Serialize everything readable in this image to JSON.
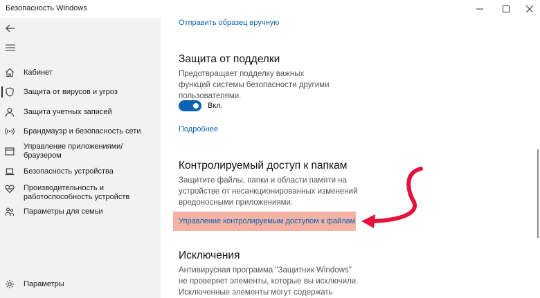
{
  "window": {
    "title": "Безопасность Windows",
    "minimize_icon": "minimize-icon",
    "maximize_icon": "maximize-icon",
    "close_icon": "close-icon"
  },
  "sidebar": {
    "back_icon": "back-arrow-icon",
    "menu_icon": "hamburger-icon",
    "items": [
      {
        "label": "Кабинет",
        "icon": "home-icon"
      },
      {
        "label": "Защита от вирусов и угроз",
        "icon": "shield-icon",
        "active": true
      },
      {
        "label": "Защита учетных записей",
        "icon": "person-icon"
      },
      {
        "label": "Брандмауэр и безопасность сети",
        "icon": "wifi-icon"
      },
      {
        "label": "Управление приложениями/браузером",
        "icon": "app-window-icon"
      },
      {
        "label": "Безопасность устройства",
        "icon": "laptop-icon"
      },
      {
        "label": "Производительность и работоспособность устройств",
        "icon": "heart-icon"
      },
      {
        "label": "Параметры для семьи",
        "icon": "family-icon"
      }
    ],
    "settings": {
      "label": "Параметры",
      "icon": "gear-icon"
    }
  },
  "content": {
    "top_link": "Отправить образец вручную",
    "tamper": {
      "heading": "Защита от подделки",
      "description": "Предотвращает подделку важных функций системы безопасности другими пользователями.",
      "toggle_state": "Вкл.",
      "toggle_on": true,
      "more_link": "Подробнее"
    },
    "cfa": {
      "heading": "Контролируемый доступ к папкам",
      "description": "Защитите файлы, папки и области памяти на устройстве от несанкционированных изменений вредоносными приложениями.",
      "manage_link": "Управление контролируемым доступом к файлам"
    },
    "exclusions": {
      "heading": "Исключения",
      "description": "Антивирусная программа \"Защитник Windows\" не проверяет элементы, которые вы исключили. Исключенные элементы могут содержать угрозы, и"
    }
  },
  "colors": {
    "accent": "#0a63b4",
    "highlight": "#f4b3a5",
    "annotation_arrow": "#e5133c",
    "sidebar_bg": "#f2f2f2"
  }
}
